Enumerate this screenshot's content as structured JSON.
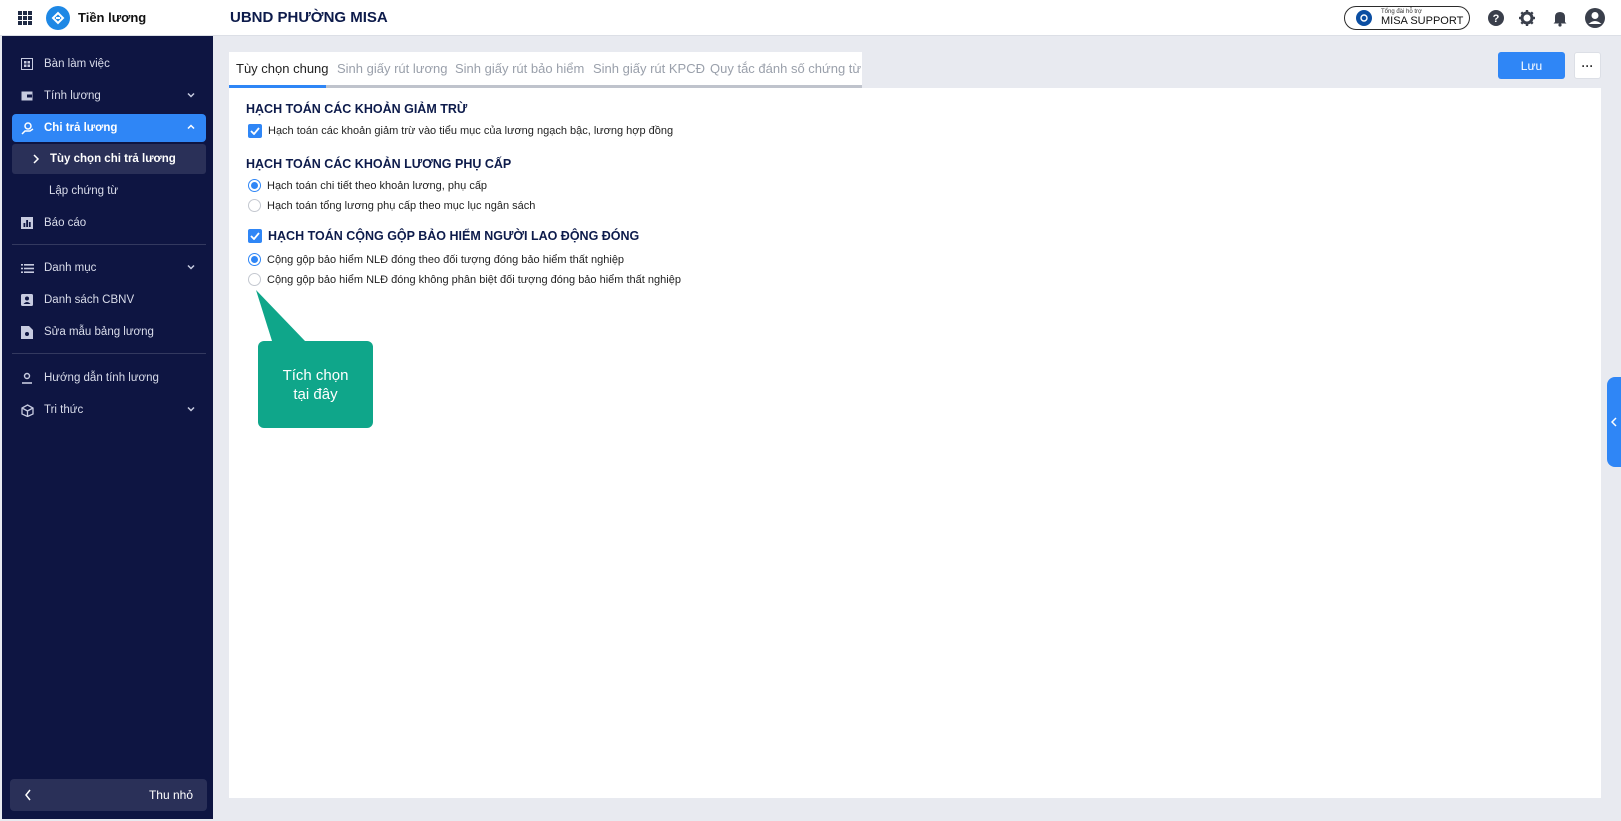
{
  "app": {
    "name": "Tiền lương",
    "org": "UBND PHƯỜNG MISA"
  },
  "support": {
    "small": "Tổng đài hỗ trợ",
    "label": "MISA SUPPORT"
  },
  "icons": {
    "help": "help-icon",
    "settings": "gear-icon",
    "notifications": "bell-icon",
    "account": "user-icon"
  },
  "sidebar": {
    "items": [
      {
        "label": "Bàn làm việc",
        "icon": "dashboard-icon"
      },
      {
        "label": "Tính lương",
        "icon": "wallet-icon"
      },
      {
        "label": "Chi trả lương",
        "icon": "payout-icon"
      },
      {
        "label": "Báo cáo",
        "icon": "report-icon"
      },
      {
        "label": "Danh mục",
        "icon": "list-icon"
      },
      {
        "label": "Danh sách CBNV",
        "icon": "staff-icon"
      },
      {
        "label": "Sửa mẫu bảng lương",
        "icon": "template-icon"
      },
      {
        "label": "Hướng dẫn tính lương",
        "icon": "guide-icon"
      },
      {
        "label": "Tri thức",
        "icon": "knowledge-icon"
      }
    ],
    "subitems": [
      {
        "label": "Tùy chọn chi trả lương"
      },
      {
        "label": "Lập chứng từ"
      }
    ],
    "collapse_label": "Thu nhỏ"
  },
  "tabs": [
    {
      "label": "Tùy chọn chung"
    },
    {
      "label": "Sinh giấy rút lương"
    },
    {
      "label": "Sinh giấy rút bảo hiểm"
    },
    {
      "label": "Sinh giấy rút KPCĐ"
    },
    {
      "label": "Quy tắc đánh số chứng từ"
    }
  ],
  "actions": {
    "save": "Lưu",
    "more": "···"
  },
  "sections": [
    {
      "title": "HẠCH TOÁN CÁC KHOẢN GIẢM TRỪ",
      "options": [
        {
          "label": "Hạch toán các khoản giảm trừ vào tiểu mục của lương ngạch bậc, lương hợp đồng",
          "checked": true
        }
      ]
    },
    {
      "title": "HẠCH TOÁN CÁC KHOẢN LƯƠNG PHỤ CẤP",
      "options": [
        {
          "label": "Hạch toán chi tiết theo khoản lương, phụ cấp",
          "selected": true
        },
        {
          "label": "Hạch toán tổng lương phụ cấp theo mục lục ngân sách",
          "selected": false
        }
      ]
    },
    {
      "title": "HẠCH TOÁN CỘNG GỘP BẢO HIỂM NGƯỜI LAO ĐỘNG ĐÓNG",
      "checked": true,
      "options": [
        {
          "label": "Cộng gộp bảo hiểm NLĐ đóng theo đối tượng đóng bảo hiểm thất nghiệp",
          "selected": true
        },
        {
          "label": "Cộng gộp bảo hiểm NLĐ đóng không phân biệt đối tượng đóng bảo hiểm thất nghiệp",
          "selected": false
        }
      ]
    }
  ],
  "callout": {
    "line1": "Tích chọn",
    "line2": "tại đây"
  },
  "colors": {
    "primary": "#2f86f6",
    "sidebar": "#0e1542",
    "callout": "#0fa68a",
    "heading": "#0d1b4b"
  }
}
